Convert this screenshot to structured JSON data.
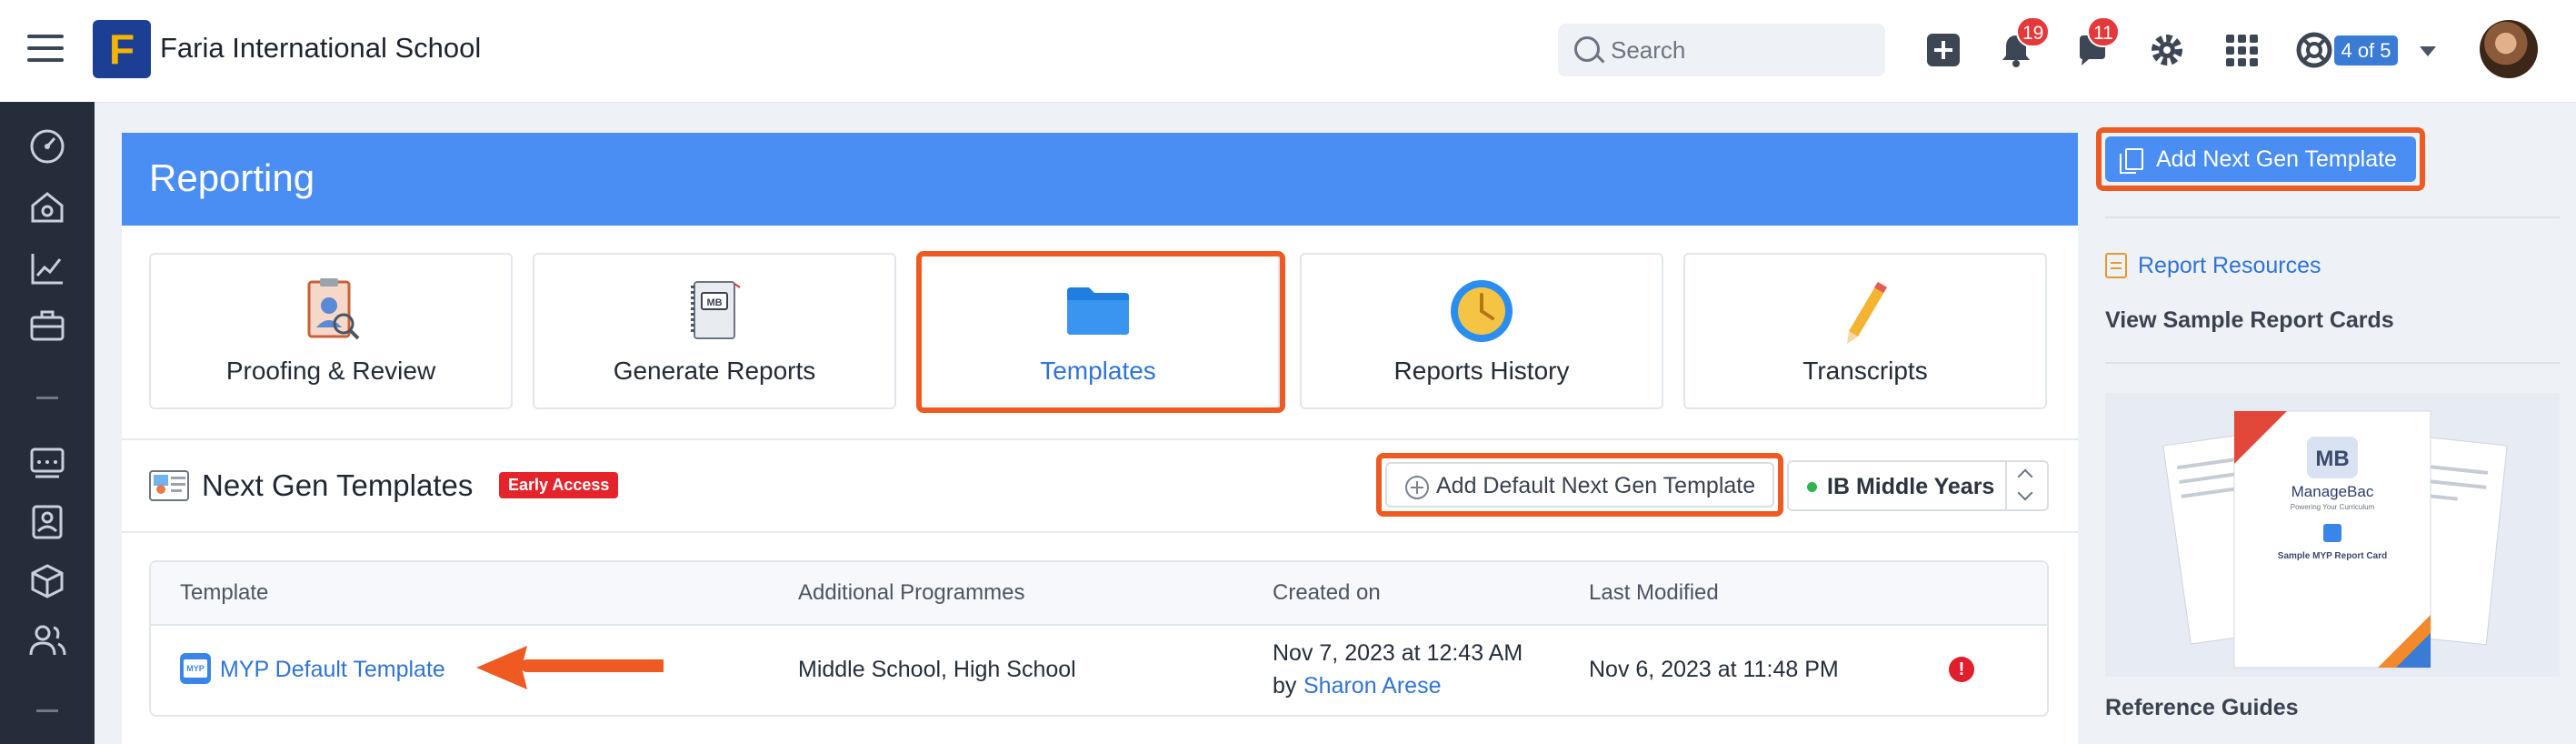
{
  "topbar": {
    "school_name": "Faria International School",
    "logo_letter": "F",
    "search_placeholder": "Search",
    "notifications_count": "19",
    "messages_count": "11",
    "pagination": "4 of 5"
  },
  "reporting": {
    "title": "Reporting",
    "tiles": [
      {
        "label": "Proofing & Review",
        "icon": "clipboard-reviewer-icon"
      },
      {
        "label": "Generate Reports",
        "icon": "report-cards-book-icon"
      },
      {
        "label": "Templates",
        "icon": "folder-icon",
        "selected": true
      },
      {
        "label": "Reports History",
        "icon": "clock-icon"
      },
      {
        "label": "Transcripts",
        "icon": "pencil-icon"
      }
    ]
  },
  "next_gen": {
    "title": "Next Gen Templates",
    "early_access": "Early Access",
    "add_default_label": "Add Default Next Gen Template",
    "programme_select": "IB Middle Years",
    "columns": [
      "Template",
      "Additional Programmes",
      "Created on",
      "Last Modified"
    ],
    "rows": [
      {
        "template": "MYP Default Template",
        "template_icon_text": "MYP",
        "programmes": "Middle School, High School",
        "created_on": "Nov 7, 2023 at 12:43 AM",
        "created_by_prefix": "by",
        "created_by": "Sharon Arese",
        "last_modified": "Nov 6, 2023 at 11:48 PM",
        "status": "error"
      }
    ]
  },
  "sidebar_right": {
    "add_next_gen_label": "Add Next Gen Template",
    "report_resources": "Report Resources",
    "view_samples": "View Sample Report Cards",
    "sample_brand": "ManageBac",
    "sample_tagline": "Powering Your Curriculum",
    "sample_caption": "Sample MYP Report Card",
    "reference_guides": "Reference Guides"
  },
  "colors": {
    "accent_blue": "#4a8ef3",
    "highlight_orange": "#ee5a22",
    "badge_red": "#e5383b",
    "sidebar_dark": "#252d3a"
  }
}
